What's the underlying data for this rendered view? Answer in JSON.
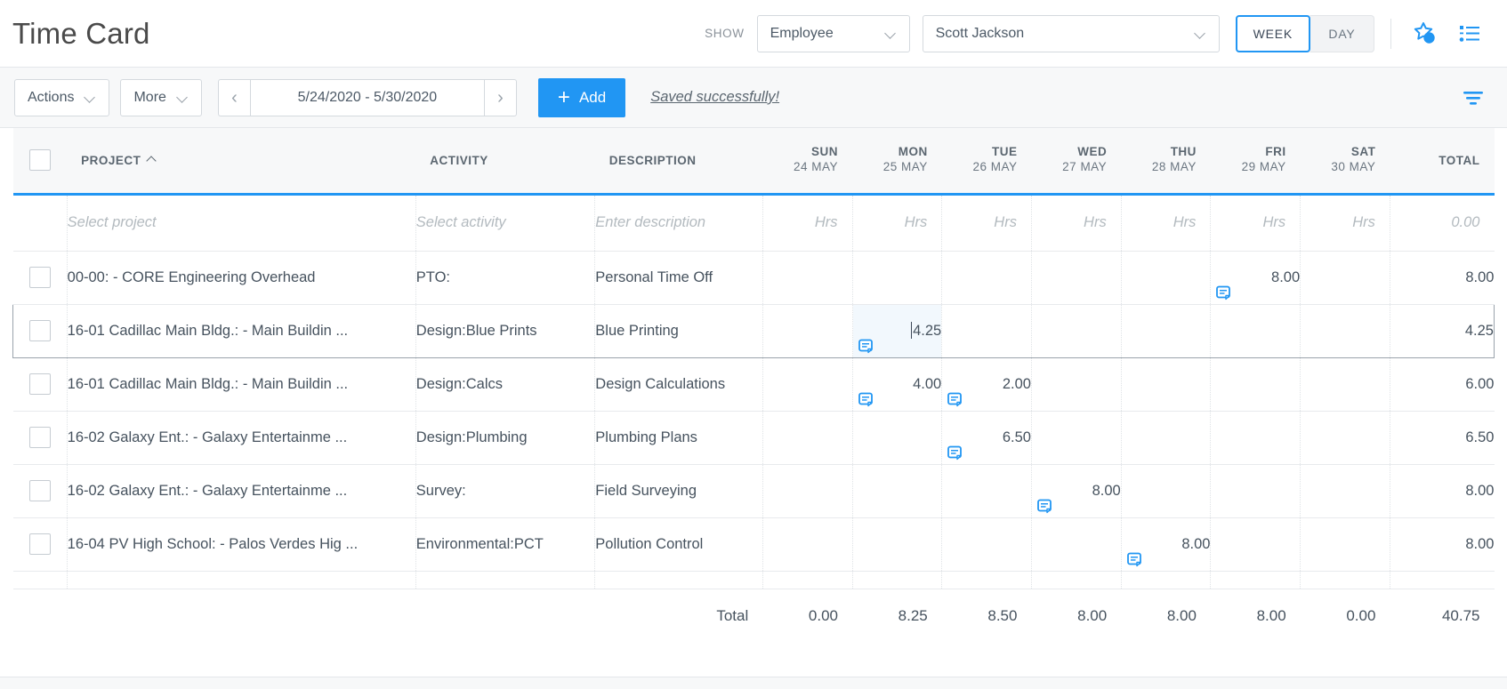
{
  "header": {
    "title": "Time Card",
    "show_label": "SHOW",
    "employee_type": "Employee",
    "employee_name": "Scott Jackson",
    "week_label": "WEEK",
    "day_label": "DAY",
    "star_icon": "star-badge-icon",
    "list_icon": "list-view-icon",
    "accent_color": "#2196f3"
  },
  "toolbar": {
    "actions_label": "Actions",
    "more_label": "More",
    "prev_label": "‹",
    "next_label": "›",
    "date_range": "5/24/2020 - 5/30/2020",
    "add_label": "Add",
    "add_plus": "+",
    "saved_message": "Saved successfully!",
    "filter_icon": "filter-icon"
  },
  "grid": {
    "columns": {
      "project": "PROJECT",
      "activity": "ACTIVITY",
      "description": "DESCRIPTION",
      "total": "TOTAL"
    },
    "days": [
      {
        "name": "SUN",
        "date": "24 MAY"
      },
      {
        "name": "MON",
        "date": "25 MAY"
      },
      {
        "name": "TUE",
        "date": "26 MAY"
      },
      {
        "name": "WED",
        "date": "27 MAY"
      },
      {
        "name": "THU",
        "date": "28 MAY"
      },
      {
        "name": "FRI",
        "date": "29 MAY"
      },
      {
        "name": "SAT",
        "date": "30 MAY"
      }
    ],
    "entry_row": {
      "project_placeholder": "Select project",
      "activity_placeholder": "Select activity",
      "description_placeholder": "Enter description",
      "hours_placeholder": "Hrs",
      "total_placeholder": "0.00"
    },
    "rows": [
      {
        "project": "00-00: - CORE Engineering Overhead",
        "activity": "PTO:",
        "description": "Personal Time Off",
        "hours": [
          "",
          "",
          "",
          "",
          "",
          "8.00",
          ""
        ],
        "notes": [
          false,
          false,
          false,
          false,
          false,
          true,
          false
        ],
        "total": "8.00",
        "selected": false,
        "active_day": -1
      },
      {
        "project": "16-01 Cadillac Main Bldg.: - Main Buildin ...",
        "activity": "Design:Blue Prints",
        "description": "Blue Printing",
        "hours": [
          "",
          "4.25",
          "",
          "",
          "",
          "",
          ""
        ],
        "notes": [
          false,
          true,
          false,
          false,
          false,
          false,
          false
        ],
        "total": "4.25",
        "selected": true,
        "active_day": 1
      },
      {
        "project": "16-01 Cadillac Main Bldg.: - Main Buildin ...",
        "activity": "Design:Calcs",
        "description": "Design Calculations",
        "hours": [
          "",
          "4.00",
          "2.00",
          "",
          "",
          "",
          ""
        ],
        "notes": [
          false,
          true,
          true,
          false,
          false,
          false,
          false
        ],
        "total": "6.00",
        "selected": false,
        "active_day": -1
      },
      {
        "project": "16-02 Galaxy Ent.: - Galaxy Entertainme  ...",
        "activity": "Design:Plumbing",
        "description": "Plumbing Plans",
        "hours": [
          "",
          "",
          "6.50",
          "",
          "",
          "",
          ""
        ],
        "notes": [
          false,
          false,
          true,
          false,
          false,
          false,
          false
        ],
        "total": "6.50",
        "selected": false,
        "active_day": -1
      },
      {
        "project": "16-02 Galaxy Ent.: - Galaxy Entertainme  ...",
        "activity": "Survey:",
        "description": "Field Surveying",
        "hours": [
          "",
          "",
          "",
          "8.00",
          "",
          "",
          ""
        ],
        "notes": [
          false,
          false,
          false,
          true,
          false,
          false,
          false
        ],
        "total": "8.00",
        "selected": false,
        "active_day": -1
      },
      {
        "project": "16-04 PV High School: - Palos Verdes Hig ...",
        "activity": "Environmental:PCT",
        "description": "Pollution Control",
        "hours": [
          "",
          "",
          "",
          "",
          "8.00",
          "",
          ""
        ],
        "notes": [
          false,
          false,
          false,
          false,
          true,
          false,
          false
        ],
        "total": "8.00",
        "selected": false,
        "active_day": -1
      }
    ],
    "totals": {
      "label": "Total",
      "days": [
        "0.00",
        "8.25",
        "8.50",
        "8.00",
        "8.00",
        "8.00",
        "0.00"
      ],
      "grand": "40.75"
    }
  }
}
